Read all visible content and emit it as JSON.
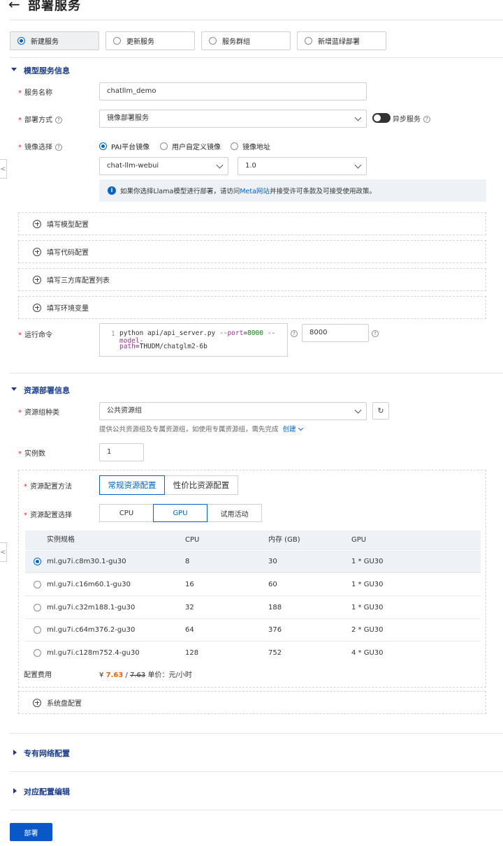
{
  "header": {
    "back_glyph": "←",
    "title": "部署服务"
  },
  "service_types": [
    {
      "label": "新建服务",
      "selected": true
    },
    {
      "label": "更新服务",
      "selected": false
    },
    {
      "label": "服务群组",
      "selected": false
    },
    {
      "label": "新增蓝绿部署",
      "selected": false
    }
  ],
  "model_section": {
    "title": "模型服务信息",
    "service_name": {
      "label": "服务名称",
      "value": "chatllm_demo"
    },
    "deploy_method": {
      "label": "部署方式",
      "value": "镜像部署服务",
      "async_label": "异步服务",
      "help": "?"
    },
    "image_select": {
      "label": "镜像选择",
      "options": [
        {
          "label": "PAI平台镜像",
          "selected": true
        },
        {
          "label": "用户自定义镜像",
          "selected": false
        },
        {
          "label": "镜像地址",
          "selected": false
        }
      ],
      "image_value": "chat-llm-webui",
      "version_value": "1.0"
    },
    "notice": {
      "icon": "i",
      "text_before": "如果你选择Llama模型进行部署，请访问",
      "link": "Meta网站",
      "text_after": "并接受许可条款及可接受使用政策。"
    },
    "panels": [
      "填写模型配置",
      "填写代码配置",
      "填写三方库配置列表",
      "填写环境变量"
    ],
    "run_command": {
      "label": "运行命令",
      "line_no": "1",
      "line1_a": "python api/api_server.py ",
      "line1_flag1": "--port",
      "line1_eq": "=",
      "line1_num": "8000",
      "line1_flag2": " --model-",
      "line2_flag": "path",
      "line2_rest": "=THUDM/chatglm2-6b",
      "port_value": "8000"
    }
  },
  "resource_section": {
    "title": "资源部署信息",
    "group_type": {
      "label": "资源组种类",
      "value": "公共资源组",
      "refresh_icon": "↻",
      "hint": "提供公共资源组及专属资源组，如使用专属资源组，需先完成",
      "hint_link": "创建"
    },
    "instances": {
      "label": "实例数",
      "value": "1"
    },
    "config_method": {
      "label": "资源配置方法",
      "options": [
        "常规资源配置",
        "性价比资源配置"
      ],
      "active": 0
    },
    "config_select": {
      "label": "资源配置选择",
      "options": [
        "CPU",
        "GPU",
        "试用活动"
      ],
      "active": 1
    },
    "table": {
      "headers": [
        "实例规格",
        "CPU",
        "内存 (GB)",
        "GPU"
      ],
      "rows": [
        {
          "spec": "ml.gu7i.c8m30.1-gu30",
          "cpu": "8",
          "mem": "30",
          "gpu": "1 * GU30",
          "selected": true
        },
        {
          "spec": "ml.gu7i.c16m60.1-gu30",
          "cpu": "16",
          "mem": "60",
          "gpu": "1 * GU30",
          "selected": false
        },
        {
          "spec": "ml.gu7i.c32m188.1-gu30",
          "cpu": "32",
          "mem": "188",
          "gpu": "1 * GU30",
          "selected": false
        },
        {
          "spec": "ml.gu7i.c64m376.2-gu30",
          "cpu": "64",
          "mem": "376",
          "gpu": "2 * GU30",
          "selected": false
        },
        {
          "spec": "ml.gu7i.c128m752.4-gu30",
          "cpu": "128",
          "mem": "752",
          "gpu": "4 * GU30",
          "selected": false
        }
      ]
    },
    "fee": {
      "label": "配置费用",
      "currency": "¥",
      "price": "7.63",
      "sep": "/",
      "orig_price": "7.63",
      "unit": "单价：元/小时"
    },
    "system_disk": "系统盘配置"
  },
  "vpc_section": {
    "title": "专有网络配置"
  },
  "config_edit_section": {
    "title": "对应配置编辑"
  },
  "submit_label": "部署",
  "side_handle_glyph": "<",
  "colors": {
    "primary": "#0a58c8",
    "link": "#0064c8",
    "price": "#e8630a",
    "section_title": "#1a3c8c"
  }
}
